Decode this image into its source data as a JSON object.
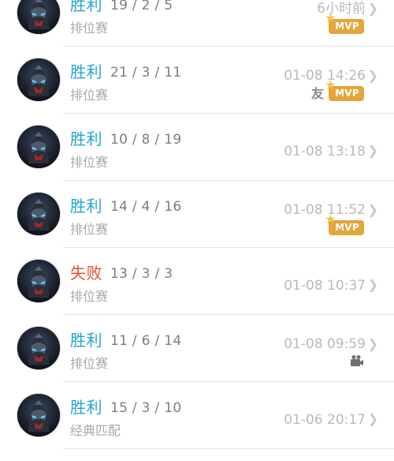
{
  "matches": [
    {
      "result": "胜利",
      "outcome": "win",
      "kda": "19 / 2 / 5",
      "mode": "排位赛",
      "time": "6小时前",
      "badges": [
        "mvp"
      ]
    },
    {
      "result": "胜利",
      "outcome": "win",
      "kda": "21 / 3 / 11",
      "mode": "排位赛",
      "time": "01-08 14:26",
      "badges": [
        "friend",
        "mvp"
      ]
    },
    {
      "result": "胜利",
      "outcome": "win",
      "kda": "10 / 8 / 19",
      "mode": "排位赛",
      "time": "01-08 13:18",
      "badges": []
    },
    {
      "result": "胜利",
      "outcome": "win",
      "kda": "14 / 4 / 16",
      "mode": "排位赛",
      "time": "01-08 11:52",
      "badges": [
        "mvp"
      ]
    },
    {
      "result": "失败",
      "outcome": "loss",
      "kda": "13 / 3 / 3",
      "mode": "排位赛",
      "time": "01-08 10:37",
      "badges": []
    },
    {
      "result": "胜利",
      "outcome": "win",
      "kda": "11 / 6 / 14",
      "mode": "排位赛",
      "time": "01-08 09:59",
      "badges": [
        "video"
      ]
    },
    {
      "result": "胜利",
      "outcome": "win",
      "kda": "15 / 3 / 10",
      "mode": "经典匹配",
      "time": "01-06 20:17",
      "badges": []
    }
  ],
  "badge_labels": {
    "mvp": "MVP",
    "friend": "友"
  },
  "icons": {
    "chevron": "chevron-right-icon",
    "avatar": "hero-avatar-icon",
    "video": "video-camera-icon",
    "star": "star-icon"
  },
  "colors": {
    "win": "#21a6cc",
    "loss": "#e8502b",
    "mvp": "#e2a63a"
  }
}
